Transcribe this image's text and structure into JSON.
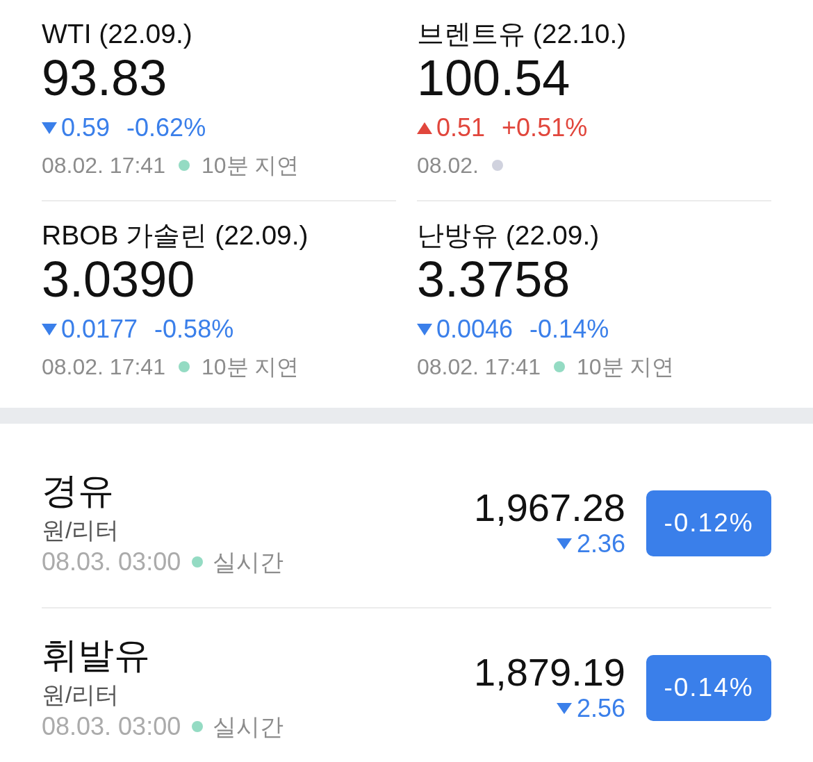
{
  "futures": [
    {
      "name": "WTI (22.09.)",
      "price": "93.83",
      "kind": "down",
      "change": "0.59",
      "change_rate": "-0.62%",
      "time": "08.02. 17:41",
      "color": "#94dbc3",
      "status": "10분 지연"
    },
    {
      "name": "브렌트유 (22.10.)",
      "price": "100.54",
      "kind": "up",
      "change": "0.51",
      "change_rate": "+0.51%",
      "time": "08.02.",
      "color": "#d0d2de"
    },
    {
      "name": "RBOB 가솔린 (22.09.)",
      "price": "3.0390",
      "kind": "down",
      "change": "0.0177",
      "change_rate": "-0.58%",
      "time": "08.02. 17:41",
      "color": "#94dbc3",
      "status": "10분 지연"
    },
    {
      "name": "난방유 (22.09.)",
      "price": "3.3758",
      "kind": "down",
      "change": "0.0046",
      "change_rate": "-0.14%",
      "time": "08.02. 17:41",
      "color": "#94dbc3",
      "status": "10분 지연"
    }
  ],
  "domestic": [
    {
      "name": "경유",
      "unit": "원/리터",
      "time": "08.03. 03:00",
      "color": "#94dbc3",
      "status": "실시간",
      "price": "1,967.28",
      "kind": "down",
      "change": "2.36",
      "change_rate": "-0.12%"
    },
    {
      "name": "휘발유",
      "unit": "원/리터",
      "time": "08.03. 03:00",
      "color": "#94dbc3",
      "status": "실시간",
      "price": "1,879.19",
      "kind": "down",
      "change": "2.56",
      "change_rate": "-0.14%"
    }
  ]
}
